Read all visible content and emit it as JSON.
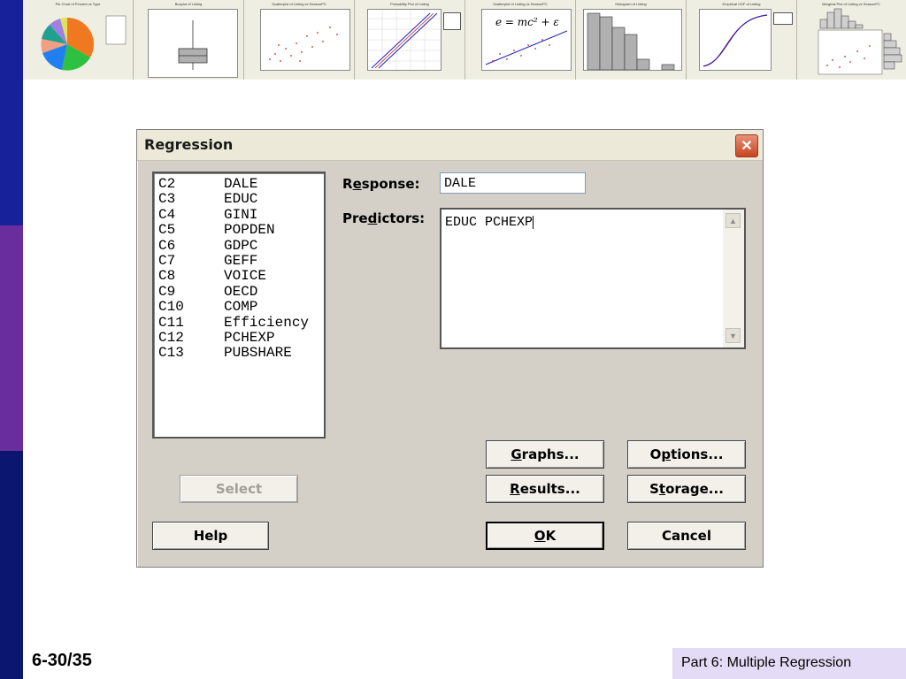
{
  "dialog": {
    "title": "Regression",
    "close_glyph": "✕"
  },
  "variables": [
    {
      "col": "C2",
      "name": "DALE"
    },
    {
      "col": "C3",
      "name": "EDUC"
    },
    {
      "col": "C4",
      "name": "GINI"
    },
    {
      "col": "C5",
      "name": "POPDEN"
    },
    {
      "col": "C6",
      "name": "GDPC"
    },
    {
      "col": "C7",
      "name": "GEFF"
    },
    {
      "col": "C8",
      "name": "VOICE"
    },
    {
      "col": "C9",
      "name": "OECD"
    },
    {
      "col": "C10",
      "name": "COMP"
    },
    {
      "col": "C11",
      "name": "Efficiency"
    },
    {
      "col": "C12",
      "name": "PCHEXP"
    },
    {
      "col": "C13",
      "name": "PUBSHARE"
    }
  ],
  "response": {
    "label_pre": "R",
    "label_u": "e",
    "label_post": "sponse:",
    "value": "DALE"
  },
  "predictors": {
    "label_pre": "Pre",
    "label_u": "d",
    "label_post": "ictors:",
    "value": "EDUC PCHEXP"
  },
  "buttons": {
    "graphs": {
      "u": "G",
      "rest": "raphs..."
    },
    "options": {
      "pre": "O",
      "u": "p",
      "rest": "tions..."
    },
    "results": {
      "u": "R",
      "rest": "esults..."
    },
    "storage": {
      "pre": "S",
      "u": "t",
      "rest": "orage..."
    },
    "select": "Select",
    "help": "Help",
    "ok": {
      "u": "O",
      "rest": "K"
    },
    "cancel": "Cancel"
  },
  "thumbnails": [
    {
      "title": "Pie Chart of Percent vs Type",
      "kind": "pie"
    },
    {
      "title": "Boxplot of Listing",
      "kind": "box"
    },
    {
      "title": "Scatterplot of Listing vs SeasonPC",
      "kind": "scatter"
    },
    {
      "title": "Probability Plot of Listing",
      "kind": "prob"
    },
    {
      "title": "Scatterplot of Listing vs SeasonPC",
      "kind": "scatter-fit"
    },
    {
      "title": "Histogram of Listing",
      "kind": "hist"
    },
    {
      "title": "Empirical CDF of Listing",
      "kind": "cdf"
    },
    {
      "title": "Marginal Plot of Listing vs SeasonPC",
      "kind": "marginal"
    }
  ],
  "thumb_formula": "e = mc² + ε",
  "footer": {
    "slide_number": "6-30/35",
    "section": "Part 6: Multiple Regression"
  },
  "colors": {
    "left_bar_top": "#17219a",
    "left_bar_mid": "#6a2d9d",
    "left_bar_bottom": "#0b1670",
    "footer_bg": "#e4dcf6"
  }
}
